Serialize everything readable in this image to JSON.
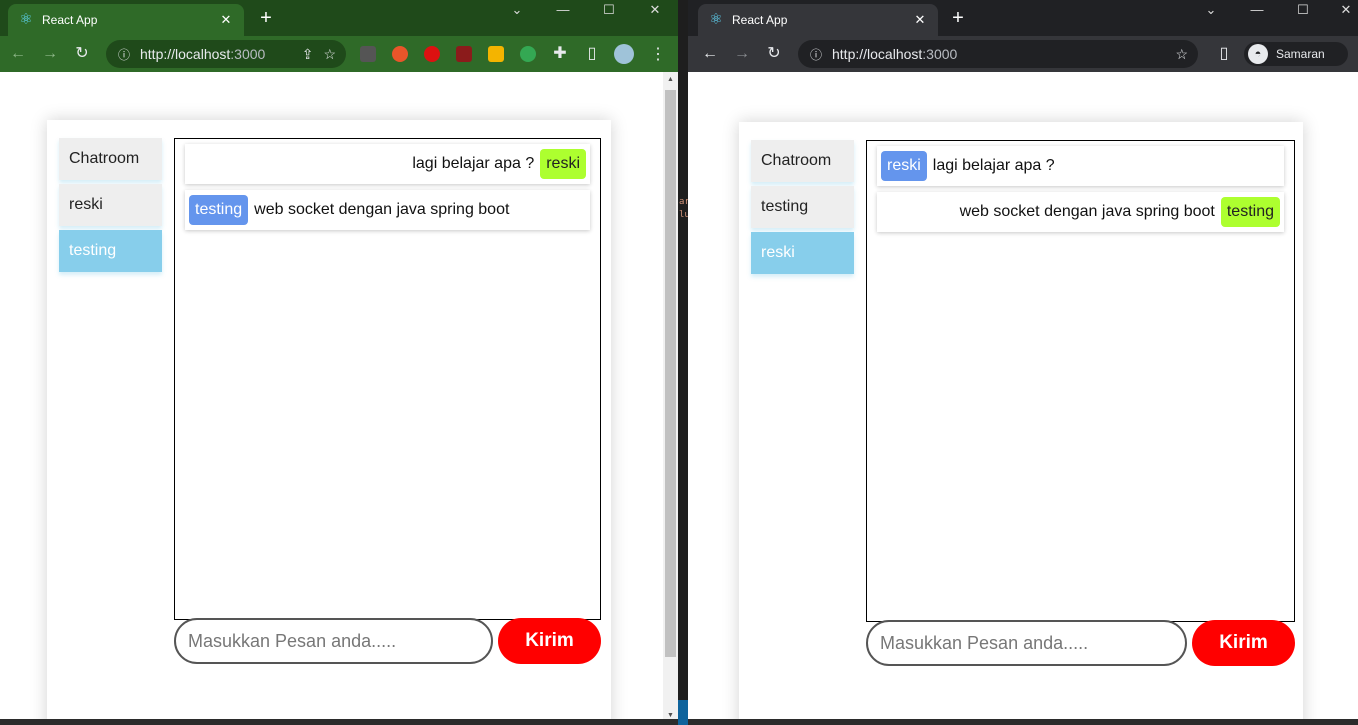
{
  "left_window": {
    "tab_title": "React App",
    "url_host": "http://localhost",
    "url_port": ":3000",
    "chat": {
      "menu": [
        "Chatroom",
        "reski",
        "testing"
      ],
      "active_index": 2,
      "messages": [
        {
          "sender": "reski",
          "text": "lagi belajar apa ?",
          "self": true
        },
        {
          "sender": "testing",
          "text": "web socket dengan java spring boot",
          "self": false
        }
      ],
      "input_placeholder": "Masukkan Pesan anda.....",
      "send_label": "Kirim"
    }
  },
  "right_window": {
    "tab_title": "React App",
    "url_host": "http://localhost",
    "url_port": ":3000",
    "profile_name": "Samaran",
    "chat": {
      "menu": [
        "Chatroom",
        "testing",
        "reski"
      ],
      "active_index": 2,
      "messages": [
        {
          "sender": "reski",
          "text": "lagi belajar apa ?",
          "self": false
        },
        {
          "sender": "testing",
          "text": "web socket dengan java spring boot",
          "self": true
        }
      ],
      "input_placeholder": "Masukkan Pesan anda.....",
      "send_label": "Kirim"
    }
  },
  "colors": {
    "active_menu": "#87ceeb",
    "other_avatar": "#6495ed",
    "self_avatar": "#adff2f",
    "send_button": "#ff0000",
    "left_chrome_theme": "#2f6a28",
    "right_chrome_theme": "#35363a"
  },
  "icons": [
    "react-logo-icon",
    "close-icon",
    "plus-icon",
    "back-icon",
    "forward-icon",
    "reload-icon",
    "info-icon",
    "share-icon",
    "star-icon",
    "puzzle-icon",
    "sidepanel-icon",
    "kebab-icon",
    "incognito-icon"
  ]
}
